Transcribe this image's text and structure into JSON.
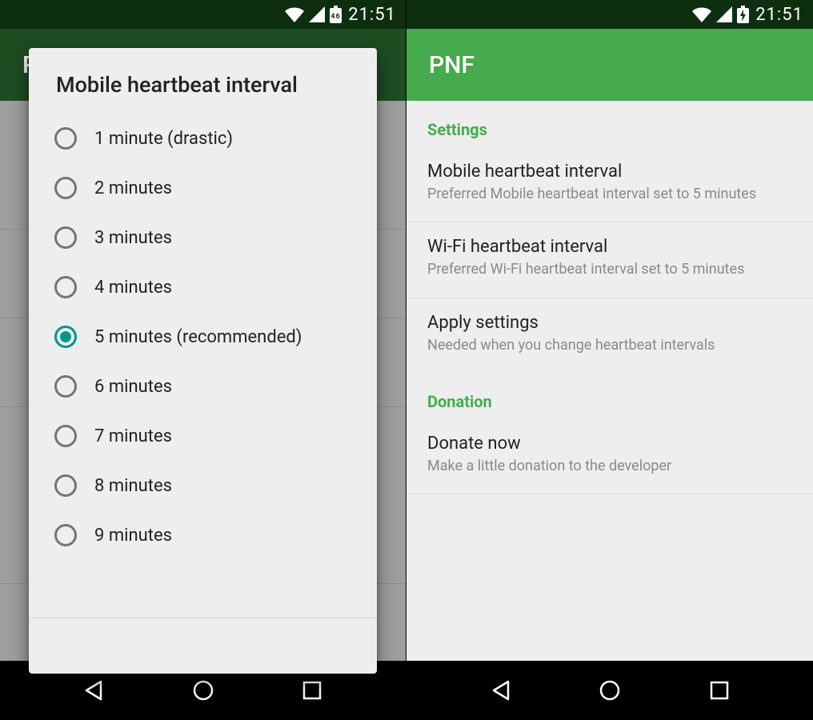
{
  "status": {
    "time_left": "21:51",
    "time_right": "21:51",
    "battery_label": "46"
  },
  "appbar": {
    "title_left": "P",
    "title_right": "PNF"
  },
  "dialog": {
    "title": "Mobile heartbeat interval",
    "options": [
      {
        "label": "1 minute (drastic)",
        "selected": false
      },
      {
        "label": "2 minutes",
        "selected": false
      },
      {
        "label": "3 minutes",
        "selected": false
      },
      {
        "label": "4 minutes",
        "selected": false
      },
      {
        "label": "5 minutes (recommended)",
        "selected": true
      },
      {
        "label": "6 minutes",
        "selected": false
      },
      {
        "label": "7 minutes",
        "selected": false
      },
      {
        "label": "8 minutes",
        "selected": false
      },
      {
        "label": "9 minutes",
        "selected": false
      }
    ]
  },
  "settings": {
    "section_a": "Settings",
    "items": [
      {
        "title": "Mobile heartbeat interval",
        "sub": "Preferred Mobile heartbeat interval set to 5 minutes"
      },
      {
        "title": "Wi-Fi heartbeat interval",
        "sub": "Preferred Wi-Fi heartbeat interval set to 5 minutes"
      },
      {
        "title": "Apply settings",
        "sub": "Needed when you change heartbeat intervals"
      }
    ],
    "section_b": "Donation",
    "donate": {
      "title": "Donate now",
      "sub": "Make a little donation to the developer"
    }
  }
}
